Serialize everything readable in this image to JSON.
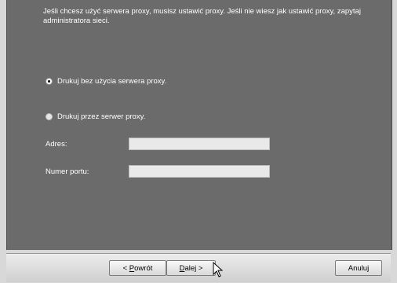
{
  "intro_text": "Jeśli chcesz użyć serwera proxy, musisz ustawić proxy. Jeśli nie wiesz jak ustawić proxy, zapytaj administratora sieci.",
  "options": [
    {
      "label": "Drukuj bez użycia serwera proxy.",
      "checked": true
    },
    {
      "label": "Drukuj przez serwer proxy.",
      "checked": false
    }
  ],
  "fields": {
    "address_label": "Adres:",
    "address_value": "",
    "port_label": "Numer portu:",
    "port_value": ""
  },
  "buttons": {
    "back_prefix": "< ",
    "back_accel": "P",
    "back_rest": "owrót",
    "next_accel": "D",
    "next_rest": "alej",
    "next_suffix": " >",
    "cancel": "Anuluj"
  }
}
